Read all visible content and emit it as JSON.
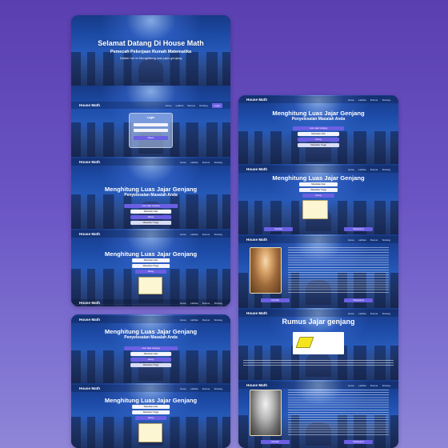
{
  "app": {
    "brand": "House Math",
    "nav_links": [
      "Home",
      "Latihan",
      "Rumus",
      "Tentang",
      "Login"
    ],
    "welcome_title": "Selamat Datang Di House Math",
    "welcome_subtitle": "Pemecah Pekerjaan Rumah Matematika",
    "welcome_desc": "Dalam hal ini Menghitung luas jajar genjang",
    "login_title": "Login",
    "login_button": "Masuk",
    "calc_title": "Menghitung Luas Jajar Genjang",
    "calc_subtitle": "Penyelesaian Masalah Anda",
    "calc_label": "Luas Jajar Genjang",
    "calc_inputs": [
      "Masukkan Alas",
      "Masukkan Tinggi"
    ],
    "calc_button": "Hitung",
    "formula_title": "Rumus Jajar genjang",
    "footer_left": "Kembali",
    "footer_right": "Selanjutnya"
  },
  "colors": {
    "background_top": "#5a3fb0",
    "background_bottom": "#8f86d8",
    "accent": "#6b5fe3",
    "navy": "#173a86"
  },
  "icons": [
    "house-math-logo",
    "shape-parallelogram-icon",
    "portrait-image"
  ]
}
